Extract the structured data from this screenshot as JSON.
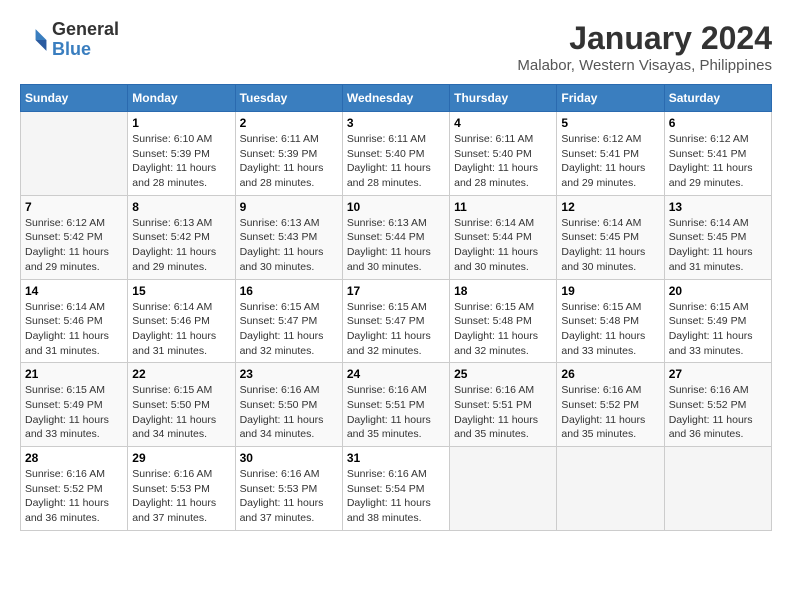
{
  "header": {
    "logo_general": "General",
    "logo_blue": "Blue",
    "main_title": "January 2024",
    "subtitle": "Malabor, Western Visayas, Philippines"
  },
  "days_of_week": [
    "Sunday",
    "Monday",
    "Tuesday",
    "Wednesday",
    "Thursday",
    "Friday",
    "Saturday"
  ],
  "weeks": [
    [
      {
        "day": "",
        "empty": true
      },
      {
        "day": "1",
        "sunrise": "6:10 AM",
        "sunset": "5:39 PM",
        "daylight": "11 hours and 28 minutes."
      },
      {
        "day": "2",
        "sunrise": "6:11 AM",
        "sunset": "5:39 PM",
        "daylight": "11 hours and 28 minutes."
      },
      {
        "day": "3",
        "sunrise": "6:11 AM",
        "sunset": "5:40 PM",
        "daylight": "11 hours and 28 minutes."
      },
      {
        "day": "4",
        "sunrise": "6:11 AM",
        "sunset": "5:40 PM",
        "daylight": "11 hours and 28 minutes."
      },
      {
        "day": "5",
        "sunrise": "6:12 AM",
        "sunset": "5:41 PM",
        "daylight": "11 hours and 29 minutes."
      },
      {
        "day": "6",
        "sunrise": "6:12 AM",
        "sunset": "5:41 PM",
        "daylight": "11 hours and 29 minutes."
      }
    ],
    [
      {
        "day": "7",
        "sunrise": "6:12 AM",
        "sunset": "5:42 PM",
        "daylight": "11 hours and 29 minutes."
      },
      {
        "day": "8",
        "sunrise": "6:13 AM",
        "sunset": "5:42 PM",
        "daylight": "11 hours and 29 minutes."
      },
      {
        "day": "9",
        "sunrise": "6:13 AM",
        "sunset": "5:43 PM",
        "daylight": "11 hours and 30 minutes."
      },
      {
        "day": "10",
        "sunrise": "6:13 AM",
        "sunset": "5:44 PM",
        "daylight": "11 hours and 30 minutes."
      },
      {
        "day": "11",
        "sunrise": "6:14 AM",
        "sunset": "5:44 PM",
        "daylight": "11 hours and 30 minutes."
      },
      {
        "day": "12",
        "sunrise": "6:14 AM",
        "sunset": "5:45 PM",
        "daylight": "11 hours and 30 minutes."
      },
      {
        "day": "13",
        "sunrise": "6:14 AM",
        "sunset": "5:45 PM",
        "daylight": "11 hours and 31 minutes."
      }
    ],
    [
      {
        "day": "14",
        "sunrise": "6:14 AM",
        "sunset": "5:46 PM",
        "daylight": "11 hours and 31 minutes."
      },
      {
        "day": "15",
        "sunrise": "6:14 AM",
        "sunset": "5:46 PM",
        "daylight": "11 hours and 31 minutes."
      },
      {
        "day": "16",
        "sunrise": "6:15 AM",
        "sunset": "5:47 PM",
        "daylight": "11 hours and 32 minutes."
      },
      {
        "day": "17",
        "sunrise": "6:15 AM",
        "sunset": "5:47 PM",
        "daylight": "11 hours and 32 minutes."
      },
      {
        "day": "18",
        "sunrise": "6:15 AM",
        "sunset": "5:48 PM",
        "daylight": "11 hours and 32 minutes."
      },
      {
        "day": "19",
        "sunrise": "6:15 AM",
        "sunset": "5:48 PM",
        "daylight": "11 hours and 33 minutes."
      },
      {
        "day": "20",
        "sunrise": "6:15 AM",
        "sunset": "5:49 PM",
        "daylight": "11 hours and 33 minutes."
      }
    ],
    [
      {
        "day": "21",
        "sunrise": "6:15 AM",
        "sunset": "5:49 PM",
        "daylight": "11 hours and 33 minutes."
      },
      {
        "day": "22",
        "sunrise": "6:15 AM",
        "sunset": "5:50 PM",
        "daylight": "11 hours and 34 minutes."
      },
      {
        "day": "23",
        "sunrise": "6:16 AM",
        "sunset": "5:50 PM",
        "daylight": "11 hours and 34 minutes."
      },
      {
        "day": "24",
        "sunrise": "6:16 AM",
        "sunset": "5:51 PM",
        "daylight": "11 hours and 35 minutes."
      },
      {
        "day": "25",
        "sunrise": "6:16 AM",
        "sunset": "5:51 PM",
        "daylight": "11 hours and 35 minutes."
      },
      {
        "day": "26",
        "sunrise": "6:16 AM",
        "sunset": "5:52 PM",
        "daylight": "11 hours and 35 minutes."
      },
      {
        "day": "27",
        "sunrise": "6:16 AM",
        "sunset": "5:52 PM",
        "daylight": "11 hours and 36 minutes."
      }
    ],
    [
      {
        "day": "28",
        "sunrise": "6:16 AM",
        "sunset": "5:52 PM",
        "daylight": "11 hours and 36 minutes."
      },
      {
        "day": "29",
        "sunrise": "6:16 AM",
        "sunset": "5:53 PM",
        "daylight": "11 hours and 37 minutes."
      },
      {
        "day": "30",
        "sunrise": "6:16 AM",
        "sunset": "5:53 PM",
        "daylight": "11 hours and 37 minutes."
      },
      {
        "day": "31",
        "sunrise": "6:16 AM",
        "sunset": "5:54 PM",
        "daylight": "11 hours and 38 minutes."
      },
      {
        "day": "",
        "empty": true
      },
      {
        "day": "",
        "empty": true
      },
      {
        "day": "",
        "empty": true
      }
    ]
  ]
}
